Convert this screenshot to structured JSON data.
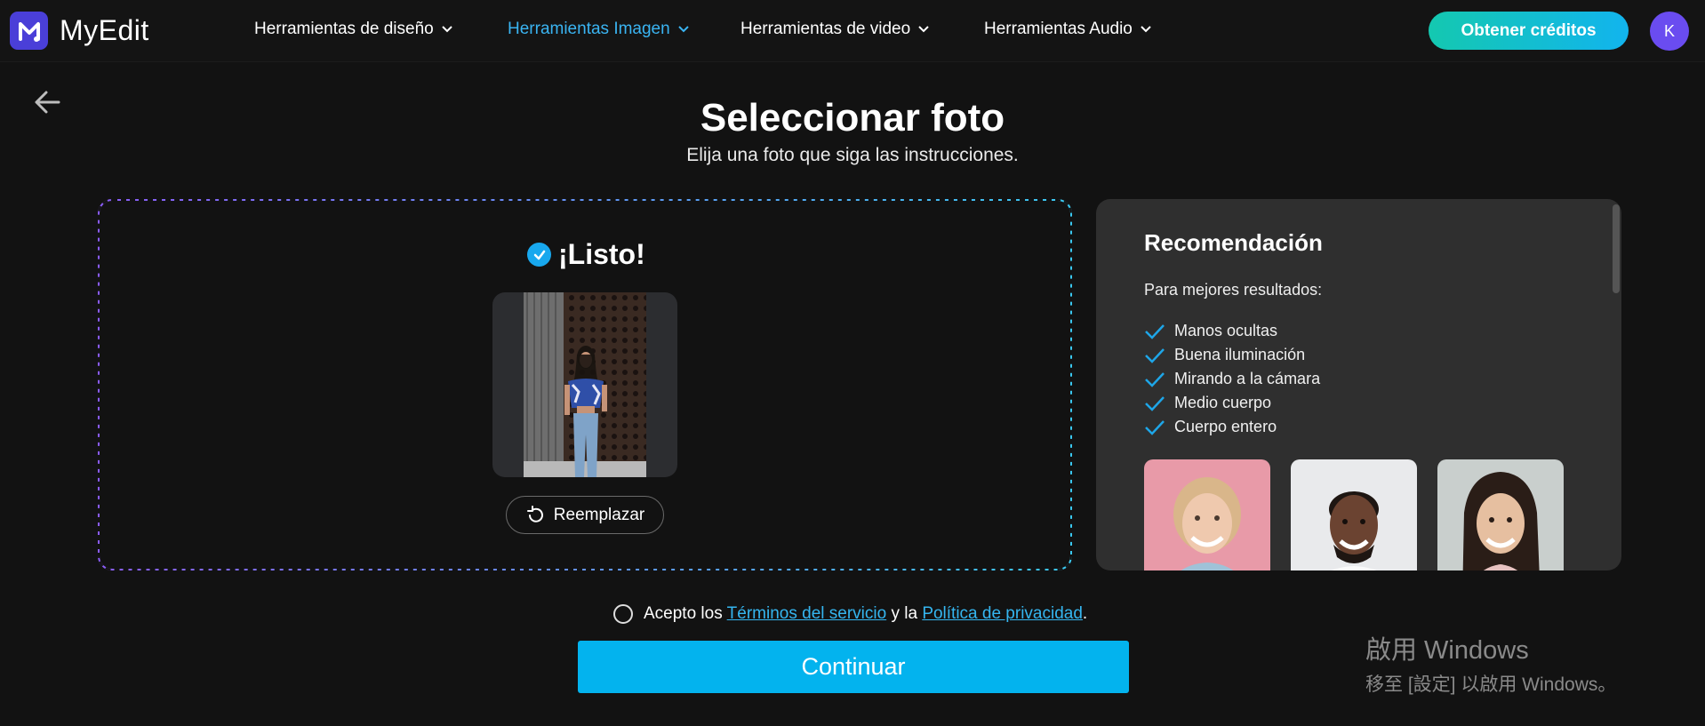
{
  "header": {
    "logo_text": "MyEdit",
    "nav": [
      {
        "label": "Herramientas de diseño"
      },
      {
        "label": "Herramientas Imagen"
      },
      {
        "label": "Herramientas de video"
      },
      {
        "label": "Herramientas Audio"
      }
    ],
    "credits_button": "Obtener créditos",
    "avatar_initial": "K"
  },
  "main": {
    "title": "Seleccionar foto",
    "subtitle": "Elija una foto que siga las instrucciones.",
    "ready_label": "¡Listo!",
    "replace_button": "Reemplazar"
  },
  "recommendation": {
    "title": "Recomendación",
    "subtitle": "Para mejores resultados:",
    "items": [
      "Manos ocultas",
      "Buena iluminación",
      "Mirando a la cámara",
      "Medio cuerpo",
      "Cuerpo entero"
    ]
  },
  "terms": {
    "prefix": "Acepto los",
    "terms_link": "Términos del servicio",
    "middle": "y la",
    "privacy_link": "Política de privacidad",
    "suffix": "."
  },
  "continue_button": "Continuar",
  "watermark": {
    "line1": "啟用 Windows",
    "line2": "移至 [設定] 以啟用 Windows。"
  },
  "colors": {
    "accent": "#03b3ee",
    "active_nav": "#3ab4f2",
    "check": "#18a8ee",
    "brand": "#4a3fd8"
  }
}
